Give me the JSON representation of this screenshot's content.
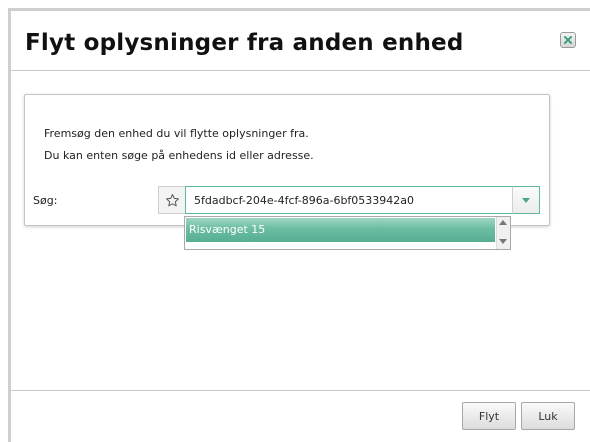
{
  "dialog": {
    "title": "Flyt oplysninger fra anden enhed",
    "close_icon": "close-x-icon"
  },
  "panel": {
    "instruction_line1": "Fremsøg den enhed du vil flytte oplysninger fra.",
    "instruction_line2": "Du kan enten søge på enhedens id eller adresse.",
    "search_label": "Søg:",
    "favorite_icon": "star-outline-icon",
    "search_value": "5fdadbcf-204e-4fcf-896a-6bf0533942a0",
    "dropdown_icon": "caret-down-icon",
    "suggestions": [
      "Risvænget 15"
    ]
  },
  "footer": {
    "move_label": "Flyt",
    "close_label": "Luk"
  },
  "colors": {
    "accent": "#5fb79c",
    "highlight": "#6bbda2"
  }
}
